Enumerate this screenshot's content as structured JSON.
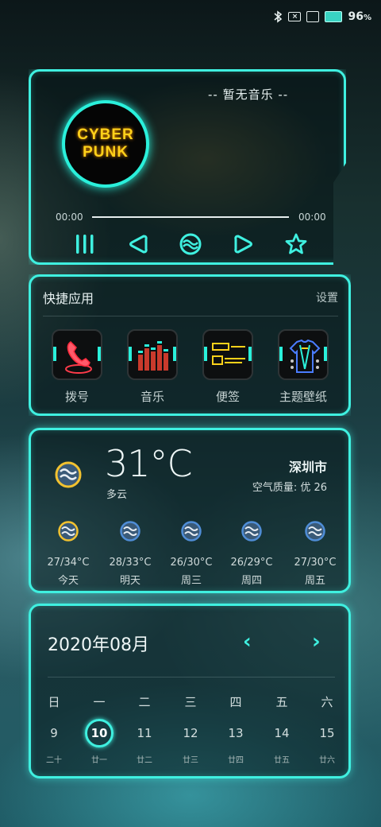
{
  "status": {
    "sim_text": "×",
    "battery": "96",
    "battery_unit": "%"
  },
  "music": {
    "title": "-- 暂无音乐 --",
    "album_line1": "CYBER",
    "album_line2": "PUNK",
    "time_current": "00:00",
    "time_total": "00:00",
    "progress": 0
  },
  "apps": {
    "title": "快捷应用",
    "settings_label": "设置",
    "items": [
      {
        "label": "拨号",
        "icon": "phone-icon"
      },
      {
        "label": "音乐",
        "icon": "equalizer-icon"
      },
      {
        "label": "便签",
        "icon": "notes-icon"
      },
      {
        "label": "主题壁纸",
        "icon": "shirt-icon"
      }
    ]
  },
  "weather": {
    "temp": "31°C",
    "condition": "多云",
    "city": "深圳市",
    "aqi": "空气质量: 优 26",
    "forecast": [
      {
        "range": "27/34°C",
        "day": "今天",
        "color": "#f2c230"
      },
      {
        "range": "28/33°C",
        "day": "明天",
        "color": "#4f8dd6"
      },
      {
        "range": "26/30°C",
        "day": "周三",
        "color": "#4f8dd6"
      },
      {
        "range": "26/29°C",
        "day": "周四",
        "color": "#4f8dd6"
      },
      {
        "range": "27/30°C",
        "day": "周五",
        "color": "#4f8dd6"
      }
    ]
  },
  "calendar": {
    "title": "2020年08月",
    "prev": "‹",
    "next": "›",
    "weekdays": [
      "日",
      "一",
      "二",
      "三",
      "四",
      "五",
      "六"
    ],
    "days": [
      "9",
      "10",
      "11",
      "12",
      "13",
      "14",
      "15"
    ],
    "lunar": [
      "二十",
      "廿一",
      "廿二",
      "廿三",
      "廿四",
      "廿五",
      "廿六"
    ]
  },
  "colors": {
    "accent": "#3ff0e0",
    "album_text": "#ffd11a"
  }
}
